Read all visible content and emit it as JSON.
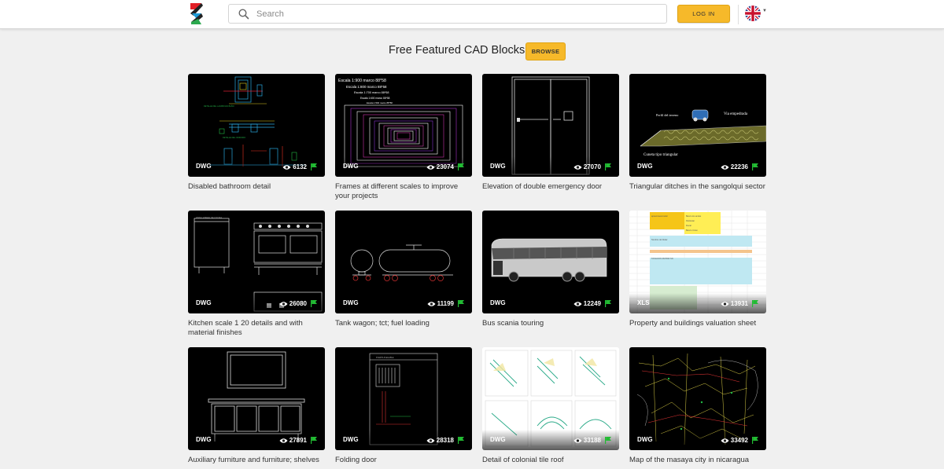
{
  "header": {
    "logo": "site-logo",
    "search": {
      "placeholder": "Search",
      "value": ""
    },
    "login_label": "LOG IN",
    "language_icon": "uk-flag-icon"
  },
  "featured": {
    "heading": "Free Featured CAD Blocks",
    "browse_label": "BROWSE"
  },
  "colors": {
    "accent": "#f6b92a",
    "flag": "#22bb33",
    "page_bg": "#f0f0f0"
  },
  "cards": [
    {
      "format": "DWG",
      "views": "6132",
      "title": "Disabled bathroom detail"
    },
    {
      "format": "DWG",
      "views": "23074",
      "title": "Frames at different scales to improve your projects"
    },
    {
      "format": "DWG",
      "views": "27070",
      "title": "Elevation of double emergency door"
    },
    {
      "format": "DWG",
      "views": "22236",
      "title": "Triangular ditches in the sangolqui sector"
    },
    {
      "format": "DWG",
      "views": "26080",
      "title": "Kitchen scale 1 20 details and with material finishes"
    },
    {
      "format": "DWG",
      "views": "11199",
      "title": "Tank wagon; tct; fuel loading"
    },
    {
      "format": "DWG",
      "views": "12249",
      "title": "Bus scania touring"
    },
    {
      "format": "XLS",
      "views": "13931",
      "title": "Property and buildings valuation sheet"
    },
    {
      "format": "DWG",
      "views": "27891",
      "title": "Auxiliary furniture and furniture; shelves"
    },
    {
      "format": "DWG",
      "views": "28318",
      "title": "Folding door"
    },
    {
      "format": "DWG",
      "views": "33188",
      "title": "Detail of colonial tile roof"
    },
    {
      "format": "DWG",
      "views": "33492",
      "title": "Map of the masaya city in nicaragua"
    }
  ],
  "thumb_text": {
    "frames": [
      "Escala 1:900 marco 88*58",
      "Escala 1:800 marco 88*58",
      "Escala 1:700 marco 88*58",
      "Escala 1:600 marco 88*58",
      "Escala 1:500 marco 88*58"
    ],
    "ditch": {
      "left": "Perfil del terreno",
      "right": "Via empedrada",
      "bottom": "Cuneta tipo triangular"
    }
  }
}
